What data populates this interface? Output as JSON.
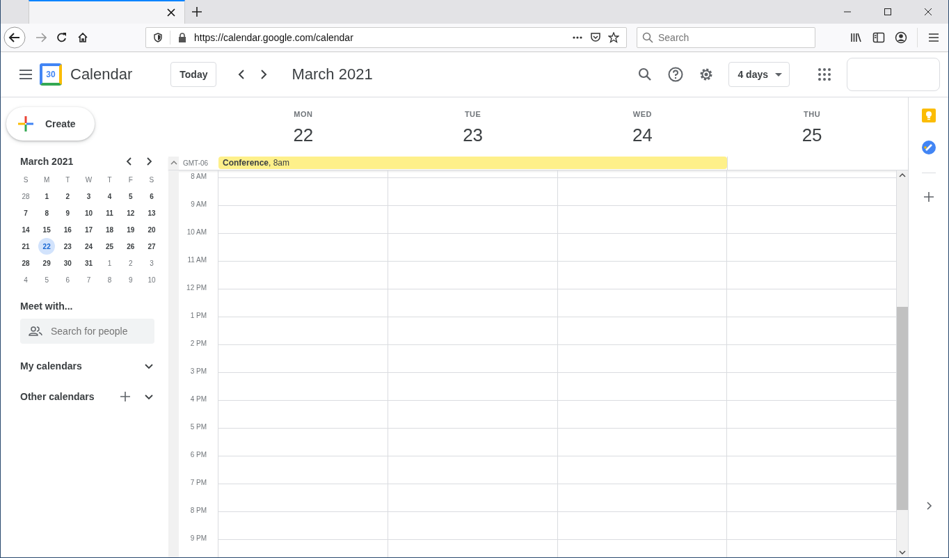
{
  "browser": {
    "url": "https://calendar.google.com/calendar",
    "search": {
      "placeholder": "Search"
    }
  },
  "app": {
    "logo_day": "30",
    "name": "Calendar",
    "today_button": "Today",
    "period": "March 2021",
    "view": "4 days"
  },
  "create_button": "Create",
  "mini_calendar": {
    "title": "March 2021",
    "weekdays": [
      "S",
      "M",
      "T",
      "W",
      "T",
      "F",
      "S"
    ],
    "weeks": [
      [
        {
          "label": "28",
          "other_month": true,
          "selected": false
        },
        {
          "label": "1",
          "other_month": false,
          "selected": false
        },
        {
          "label": "2",
          "other_month": false,
          "selected": false
        },
        {
          "label": "3",
          "other_month": false,
          "selected": false
        },
        {
          "label": "4",
          "other_month": false,
          "selected": false
        },
        {
          "label": "5",
          "other_month": false,
          "selected": false
        },
        {
          "label": "6",
          "other_month": false,
          "selected": false
        }
      ],
      [
        {
          "label": "7",
          "other_month": false,
          "selected": false
        },
        {
          "label": "8",
          "other_month": false,
          "selected": false
        },
        {
          "label": "9",
          "other_month": false,
          "selected": false
        },
        {
          "label": "10",
          "other_month": false,
          "selected": false
        },
        {
          "label": "11",
          "other_month": false,
          "selected": false
        },
        {
          "label": "12",
          "other_month": false,
          "selected": false
        },
        {
          "label": "13",
          "other_month": false,
          "selected": false
        }
      ],
      [
        {
          "label": "14",
          "other_month": false,
          "selected": false
        },
        {
          "label": "15",
          "other_month": false,
          "selected": false
        },
        {
          "label": "16",
          "other_month": false,
          "selected": false
        },
        {
          "label": "17",
          "other_month": false,
          "selected": false
        },
        {
          "label": "18",
          "other_month": false,
          "selected": false
        },
        {
          "label": "19",
          "other_month": false,
          "selected": false
        },
        {
          "label": "20",
          "other_month": false,
          "selected": false
        }
      ],
      [
        {
          "label": "21",
          "other_month": false,
          "selected": false
        },
        {
          "label": "22",
          "other_month": false,
          "selected": true
        },
        {
          "label": "23",
          "other_month": false,
          "selected": false
        },
        {
          "label": "24",
          "other_month": false,
          "selected": false
        },
        {
          "label": "25",
          "other_month": false,
          "selected": false
        },
        {
          "label": "26",
          "other_month": false,
          "selected": false
        },
        {
          "label": "27",
          "other_month": false,
          "selected": false
        }
      ],
      [
        {
          "label": "28",
          "other_month": false,
          "selected": false
        },
        {
          "label": "29",
          "other_month": false,
          "selected": false
        },
        {
          "label": "30",
          "other_month": false,
          "selected": false
        },
        {
          "label": "31",
          "other_month": false,
          "selected": false
        },
        {
          "label": "1",
          "other_month": true,
          "selected": false
        },
        {
          "label": "2",
          "other_month": true,
          "selected": false
        },
        {
          "label": "3",
          "other_month": true,
          "selected": false
        }
      ],
      [
        {
          "label": "4",
          "other_month": true,
          "selected": false
        },
        {
          "label": "5",
          "other_month": true,
          "selected": false
        },
        {
          "label": "6",
          "other_month": true,
          "selected": false
        },
        {
          "label": "7",
          "other_month": true,
          "selected": false
        },
        {
          "label": "8",
          "other_month": true,
          "selected": false
        },
        {
          "label": "9",
          "other_month": true,
          "selected": false
        },
        {
          "label": "10",
          "other_month": true,
          "selected": false
        }
      ]
    ]
  },
  "meet_with": {
    "title": "Meet with...",
    "placeholder": "Search for people"
  },
  "calendar_sections": [
    {
      "label": "My calendars",
      "can_add": false
    },
    {
      "label": "Other calendars",
      "can_add": true
    }
  ],
  "days": [
    {
      "weekday": "MON",
      "date": "22"
    },
    {
      "weekday": "TUE",
      "date": "23"
    },
    {
      "weekday": "WED",
      "date": "24"
    },
    {
      "weekday": "THU",
      "date": "25"
    }
  ],
  "timezone": "GMT-06",
  "all_day_events": [
    {
      "label": "**Conference**, 8am",
      "color": "#fef08a",
      "covers": [
        true,
        true,
        true,
        false
      ]
    }
  ],
  "hours": [
    "8 AM",
    "9 AM",
    "10 AM",
    "11 AM",
    "12 PM",
    "1 PM",
    "2 PM",
    "3 PM",
    "4 PM",
    "5 PM",
    "6 PM",
    "7 PM",
    "8 PM",
    "9 PM"
  ]
}
